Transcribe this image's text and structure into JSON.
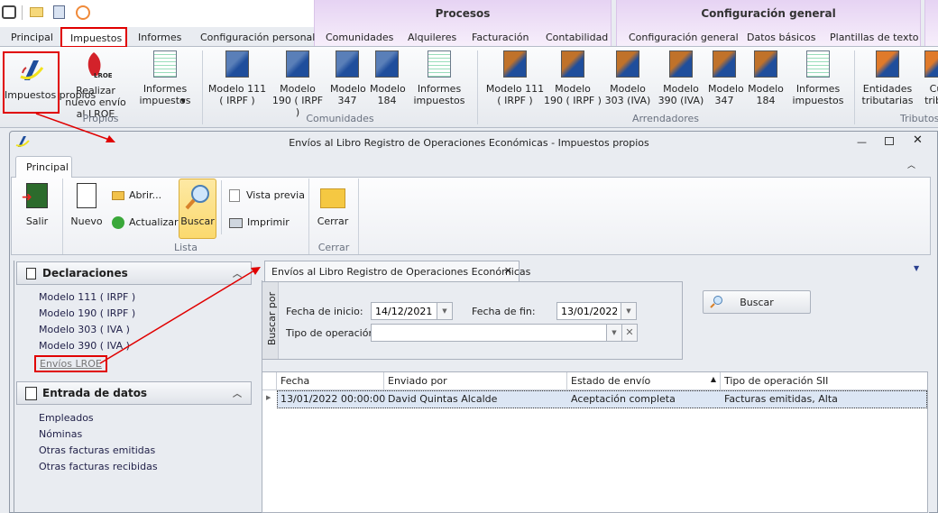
{
  "quick_access": {
    "icons": [
      "phone-icon",
      "mail-icon",
      "clipboard-icon",
      "broadcast-icon"
    ]
  },
  "context_groups": {
    "procesos": "Procesos",
    "config": "Configuración general"
  },
  "tabs": [
    "Principal",
    "Impuestos",
    "Informes",
    "Configuración personal",
    "Comunidades",
    "Alquileres",
    "Facturación",
    "Contabilidad",
    "Configuración general",
    "Datos básicos",
    "Plantillas de texto"
  ],
  "ribbon": {
    "propios": {
      "label": "Propios",
      "buttons": [
        "Impuestos propios",
        "Realizar nuevo envío al LROE",
        "Informes impuestos"
      ],
      "lroe": "LROE"
    },
    "comunidades": {
      "label": "Comunidades",
      "buttons": [
        "Modelo 111 ( IRPF )",
        "Modelo 190 ( IRPF )",
        "Modelo 347",
        "Modelo 184",
        "Informes impuestos"
      ]
    },
    "arrendadores": {
      "label": "Arrendadores",
      "buttons": [
        "Modelo 111 ( IRPF )",
        "Modelo 190 ( IRPF )",
        "Modelo 303 (IVA)",
        "Modelo 390 (IVA)",
        "Modelo 347",
        "Modelo 184",
        "Informes impuestos"
      ]
    },
    "tributos": {
      "label": "Tributos",
      "buttons": [
        "Entidades tributarias",
        "Cu tribu"
      ]
    }
  },
  "window": {
    "title": "Envíos al Libro Registro de Operaciones Económicas - Impuestos propios",
    "tab": "Principal",
    "ribbon": {
      "salir": "Salir",
      "nuevo": "Nuevo",
      "abrir": "Abrir...",
      "actualizar": "Actualizar",
      "buscar": "Buscar",
      "vista_previa": "Vista previa",
      "imprimir": "Imprimir",
      "lista": "Lista",
      "cerrar": "Cerrar",
      "cerrar_group": "Cerrar"
    }
  },
  "sidebar": {
    "declaraciones": {
      "title": "Declaraciones",
      "items": [
        "Modelo 111 ( IRPF )",
        "Modelo 190 ( IRPF )",
        "Modelo 303 ( IVA )",
        "Modelo 390 ( IVA )",
        "Envíos LROE"
      ]
    },
    "entrada": {
      "title": "Entrada de datos",
      "items": [
        "Empleados",
        "Nóminas",
        "Otras facturas emitidas",
        "Otras facturas recibidas"
      ]
    }
  },
  "document": {
    "tab": "Envíos al Libro Registro de Operaciones Económicas",
    "search": {
      "group": "Buscar por",
      "fecha_inicio_label": "Fecha de inicio:",
      "fecha_inicio": "14/12/2021",
      "fecha_fin_label": "Fecha de fin:",
      "fecha_fin": "13/01/2022",
      "tipo_label": "Tipo de operación:",
      "tipo": "",
      "button": "Buscar"
    },
    "table": {
      "columns": [
        "Fecha",
        "Enviado por",
        "Estado de envío",
        "Tipo de operación SII"
      ],
      "sorted_column": "Estado de envío",
      "rows": [
        [
          "13/01/2022 00:00:00",
          "David Quintas Alcalde",
          "Aceptación completa",
          "Facturas emitidas, Alta"
        ]
      ]
    }
  },
  "colors": {
    "highlight": "#e00000",
    "selected_row": "#dce6f4",
    "buscar_active": "#fbd96e"
  }
}
